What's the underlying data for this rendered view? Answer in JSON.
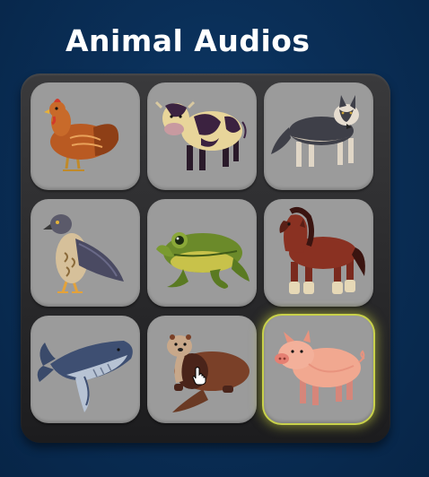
{
  "app": {
    "title": "Animal Audios"
  },
  "grid": {
    "tiles": [
      {
        "animal": "chicken",
        "icon": "chicken-icon",
        "selected": false
      },
      {
        "animal": "cow",
        "icon": "cow-icon",
        "selected": false
      },
      {
        "animal": "wolf",
        "icon": "wolf-icon",
        "selected": false
      },
      {
        "animal": "hawk",
        "icon": "hawk-icon",
        "selected": false
      },
      {
        "animal": "frog",
        "icon": "frog-icon",
        "selected": false
      },
      {
        "animal": "horse",
        "icon": "horse-icon",
        "selected": false
      },
      {
        "animal": "whale",
        "icon": "whale-icon",
        "selected": false
      },
      {
        "animal": "otter",
        "icon": "otter-icon",
        "selected": false
      },
      {
        "animal": "pig",
        "icon": "pig-icon",
        "selected": true
      }
    ]
  },
  "colors": {
    "background": "#0a2f58",
    "board": "#2a2a2c",
    "tile": "#9b9b9b",
    "selected_glow": "#c8d14a"
  }
}
